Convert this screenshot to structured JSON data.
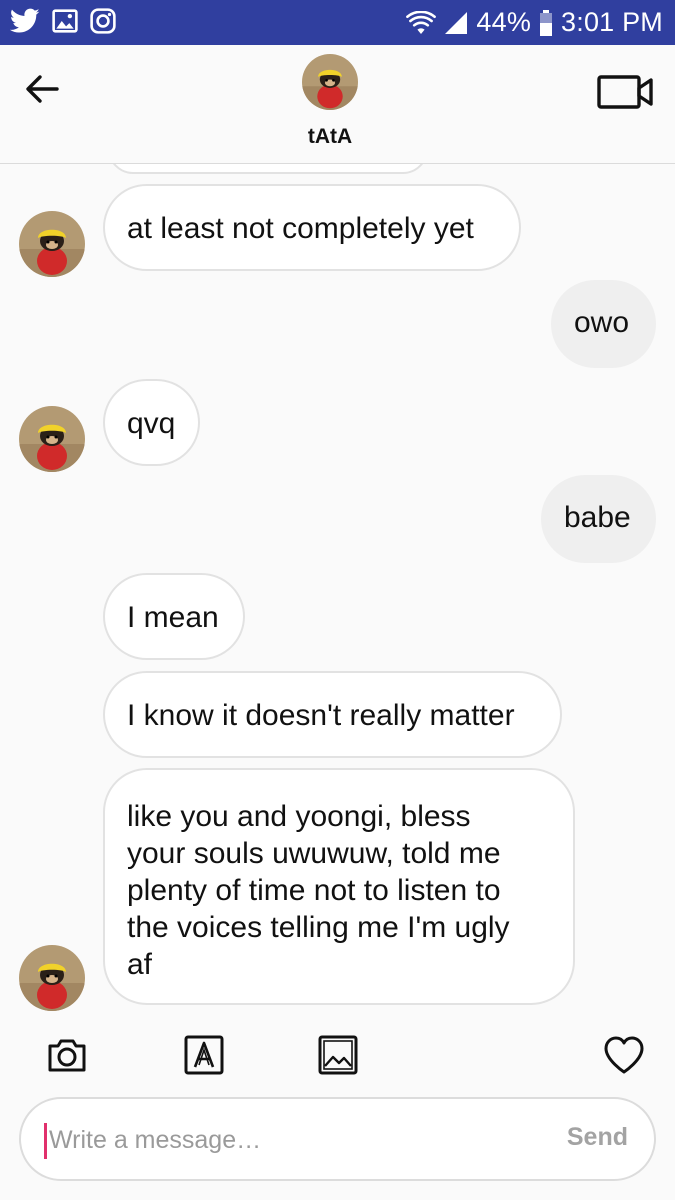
{
  "status_bar": {
    "notification_icons": [
      "twitter-icon",
      "gallery-icon",
      "instagram-icon"
    ],
    "battery": "44%",
    "time": "3:01 PM"
  },
  "header": {
    "back_icon": "arrow-left-icon",
    "title": "tAtA",
    "video_icon": "video-camera-icon"
  },
  "messages": [
    {
      "direction": "incoming",
      "text": "at least not completely yet"
    },
    {
      "direction": "outgoing",
      "text": "owo"
    },
    {
      "direction": "incoming",
      "text": "qvq"
    },
    {
      "direction": "outgoing",
      "text": "babe"
    },
    {
      "direction": "incoming",
      "text": "I mean"
    },
    {
      "direction": "incoming",
      "text": "I know it doesn't really matter"
    },
    {
      "direction": "incoming",
      "text": "like you and yoongi, bless\nyour souls uwuwuw, told me\nplenty of time not to listen to\nthe voices telling me I'm ugly\naf"
    }
  ],
  "toolbar": {
    "icons": [
      "camera-icon",
      "text-style-icon",
      "image-icon",
      "heart-icon"
    ]
  },
  "composer": {
    "placeholder": "Write a message…",
    "send_label": "Send"
  },
  "colors": {
    "status_bar": "#303f9f",
    "accent_caret": "#e1306c",
    "incoming_bubble_border": "#e2e2e2",
    "outgoing_bubble": "#efefef"
  }
}
